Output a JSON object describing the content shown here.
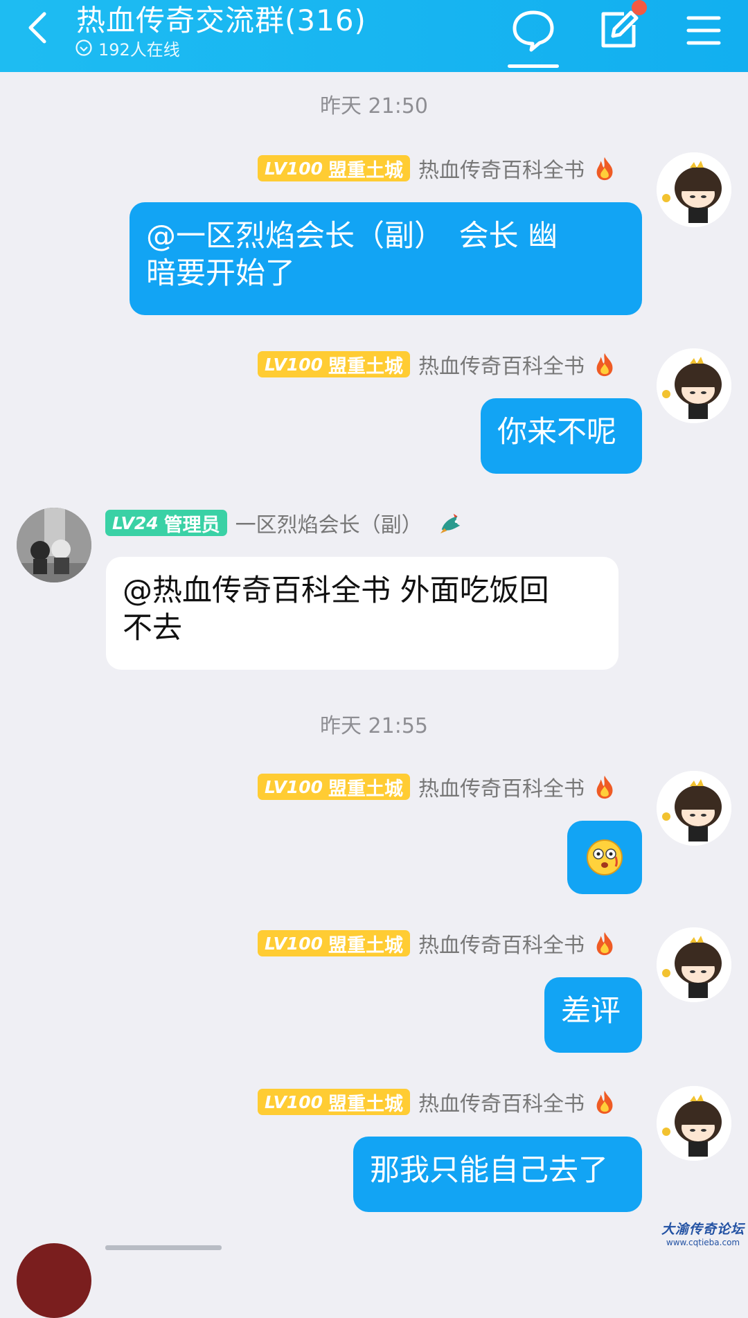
{
  "header": {
    "title": "热血传奇交流群(316)",
    "online": "192人在线",
    "back_icon": "chevron-left-icon",
    "chat_icon": "chat-bubble-icon",
    "edit_icon": "edit-icon",
    "menu_icon": "menu-icon",
    "color": "#12aff0"
  },
  "timestamps": [
    "昨天 21:50",
    "昨天 21:55"
  ],
  "me": {
    "level": "LV100",
    "title": "盟重土城",
    "nickname": "热血传奇百科全书",
    "emblem": "fire-icon"
  },
  "other": {
    "level": "LV24",
    "title": "管理员",
    "nickname": "一区烈焰会长（副）",
    "emblem": "dragon-icon"
  },
  "messages": [
    {
      "text_line1": "@一区烈焰会长（副）　会长 幽",
      "text_line2": "暗要开始了"
    },
    {
      "text": "你来不呢"
    },
    {
      "text_line1": "@热血传奇百科全书 外面吃饭回",
      "text_line2": "不去"
    },
    {
      "emoji": "shocked-emoji-icon"
    },
    {
      "text": "差评"
    },
    {
      "text": "那我只能自己去了"
    }
  ],
  "watermark": {
    "line1": "大渝传奇论坛",
    "line2": "www.cqtieba.com"
  },
  "colors": {
    "bubble_me": "#12a4f4",
    "bubble_other": "#ffffff",
    "badge_gold": "#ffcc33",
    "badge_green": "#3ad1a5"
  }
}
